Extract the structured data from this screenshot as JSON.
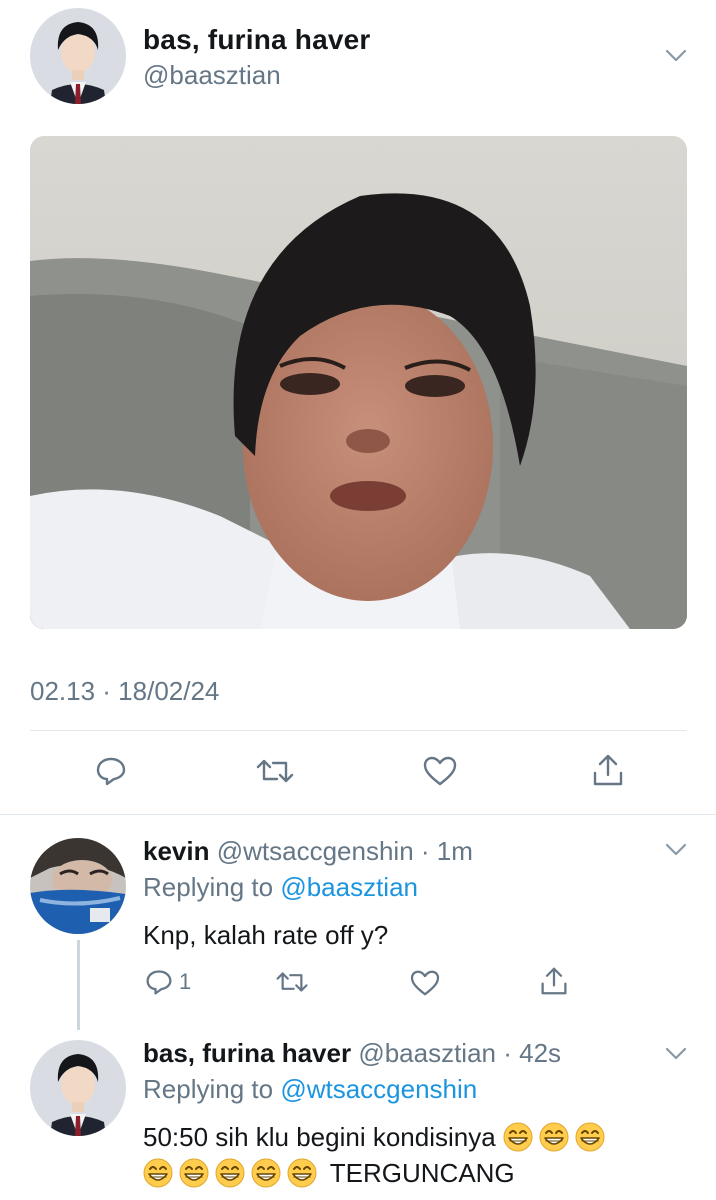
{
  "tweet": {
    "display_name": "bas, furina haver",
    "handle": "@baasztian",
    "avatar_icon": "profile-photo-avatar",
    "image_icon": "attached-photo",
    "timestamp": "02.13 · 18/02/24",
    "actions": {
      "reply_icon": "reply-icon",
      "retweet_icon": "retweet-icon",
      "like_icon": "like-heart-icon",
      "share_icon": "share-icon"
    },
    "menu_icon": "chevron-down-icon"
  },
  "replies": [
    {
      "display_name": "kevin",
      "handle_time": "@wtsaccgenshin · 1m",
      "replying_prefix": "Replying to",
      "replying_to": "@baasztian",
      "text": "Knp, kalah rate off y?",
      "reply_count": "1"
    },
    {
      "display_name": "bas, furina haver",
      "handle_time": "@baasztian · 42s",
      "replying_prefix": "Replying to",
      "replying_to": "@wtsaccgenshin",
      "text_line1": "50:50 sih klu begini kondisinya",
      "text_line2_suffix": "TERGUNCANG",
      "emoji_name": "grinning-face-with-smiling-eyes"
    }
  ],
  "colors": {
    "secondary_text": "#657786",
    "link": "#1b95e0",
    "divider": "#e1e8ed"
  }
}
